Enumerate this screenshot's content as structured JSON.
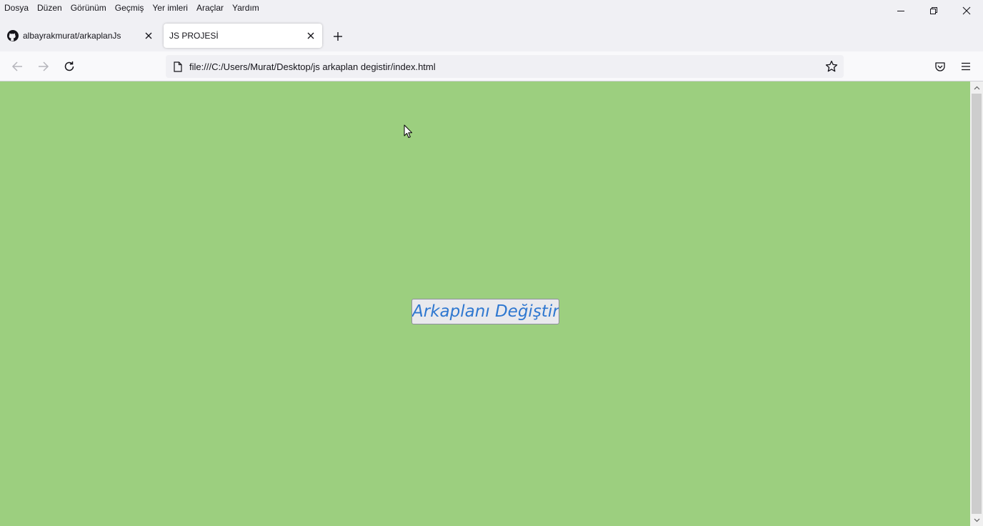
{
  "menubar": {
    "items": [
      "Dosya",
      "Düzen",
      "Görünüm",
      "Geçmiş",
      "Yer imleri",
      "Araçlar",
      "Yardım"
    ]
  },
  "window_controls": {
    "minimize_icon": "minimize-icon",
    "restore_icon": "restore-icon",
    "close_icon": "close-icon"
  },
  "tabs": [
    {
      "title": "albayrakmurat/arkaplanJs",
      "icon": "github-icon",
      "active": false
    },
    {
      "title": "JS PROJESİ",
      "icon": "none",
      "active": true
    }
  ],
  "navbar": {
    "url": "file:///C:/Users/Murat/Desktop/js arkaplan degistir/index.html"
  },
  "page": {
    "background_color": "#9ccf7f",
    "button_label": "Arkaplanı Değiştir",
    "button_text_color": "#2e77d0"
  }
}
